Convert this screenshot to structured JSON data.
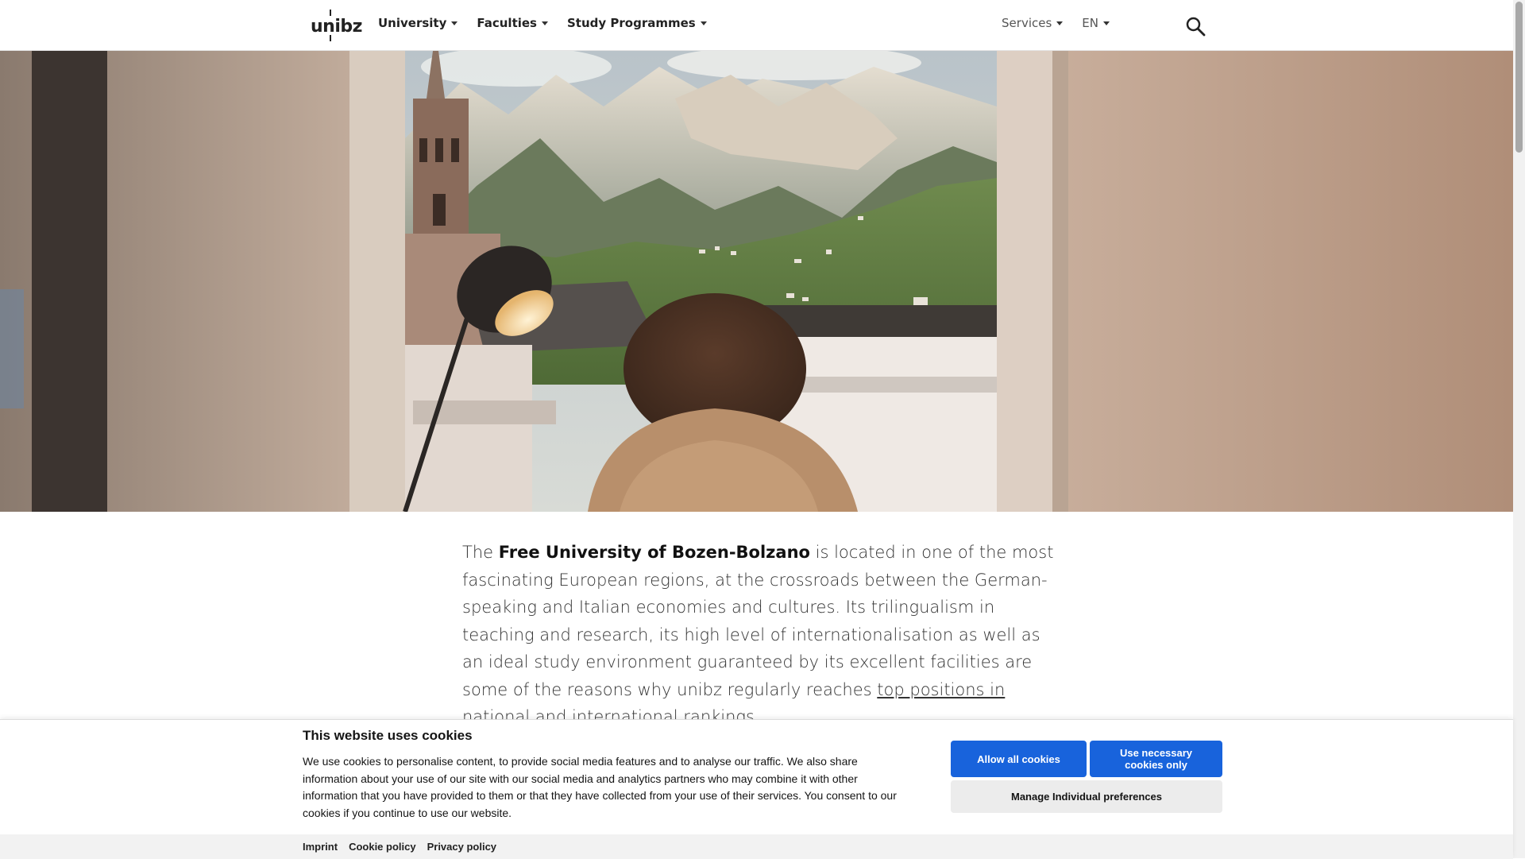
{
  "header": {
    "logo": "unibz",
    "nav_left": [
      {
        "label": "University"
      },
      {
        "label": "Faculties"
      },
      {
        "label": "Study Programmes"
      }
    ],
    "nav_right": [
      {
        "label": "Services"
      },
      {
        "label": "EN"
      }
    ],
    "search_icon": "search-icon"
  },
  "hero": {
    "image_description": "photo-window-view-bolzano"
  },
  "intro": {
    "text_before": "The ",
    "university_name": "Free University of Bozen-Bolzano",
    "text_middle": " is located in one of the most fascinating European regions, at the crossroads between the German-speaking and Italian economies and cultures. Its trilingualism in teaching and research, its high level of internationalisation as well as an ideal study environment guaranteed by its excellent facilities are some of the reasons why unibz regularly reaches ",
    "link_text": "top positions in national and international rankings",
    "text_after": "."
  },
  "cookie_banner": {
    "title": "This website uses cookies",
    "text": "We use cookies to personalise content, to provide social media features and to analyse our traffic. We also share information about your use of our site with our social media and analytics partners who may combine it with other information that you have provided to them or that they have collected from your use of their services. You consent to our cookies if you continue to use our website.",
    "allow_all": "Allow all cookies",
    "necessary_only": "Use necessary cookies only",
    "manage": "Manage Individual preferences",
    "footer_links": [
      "Imprint",
      "Cookie policy",
      "Privacy policy"
    ],
    "primary_color": "#1863dc"
  }
}
